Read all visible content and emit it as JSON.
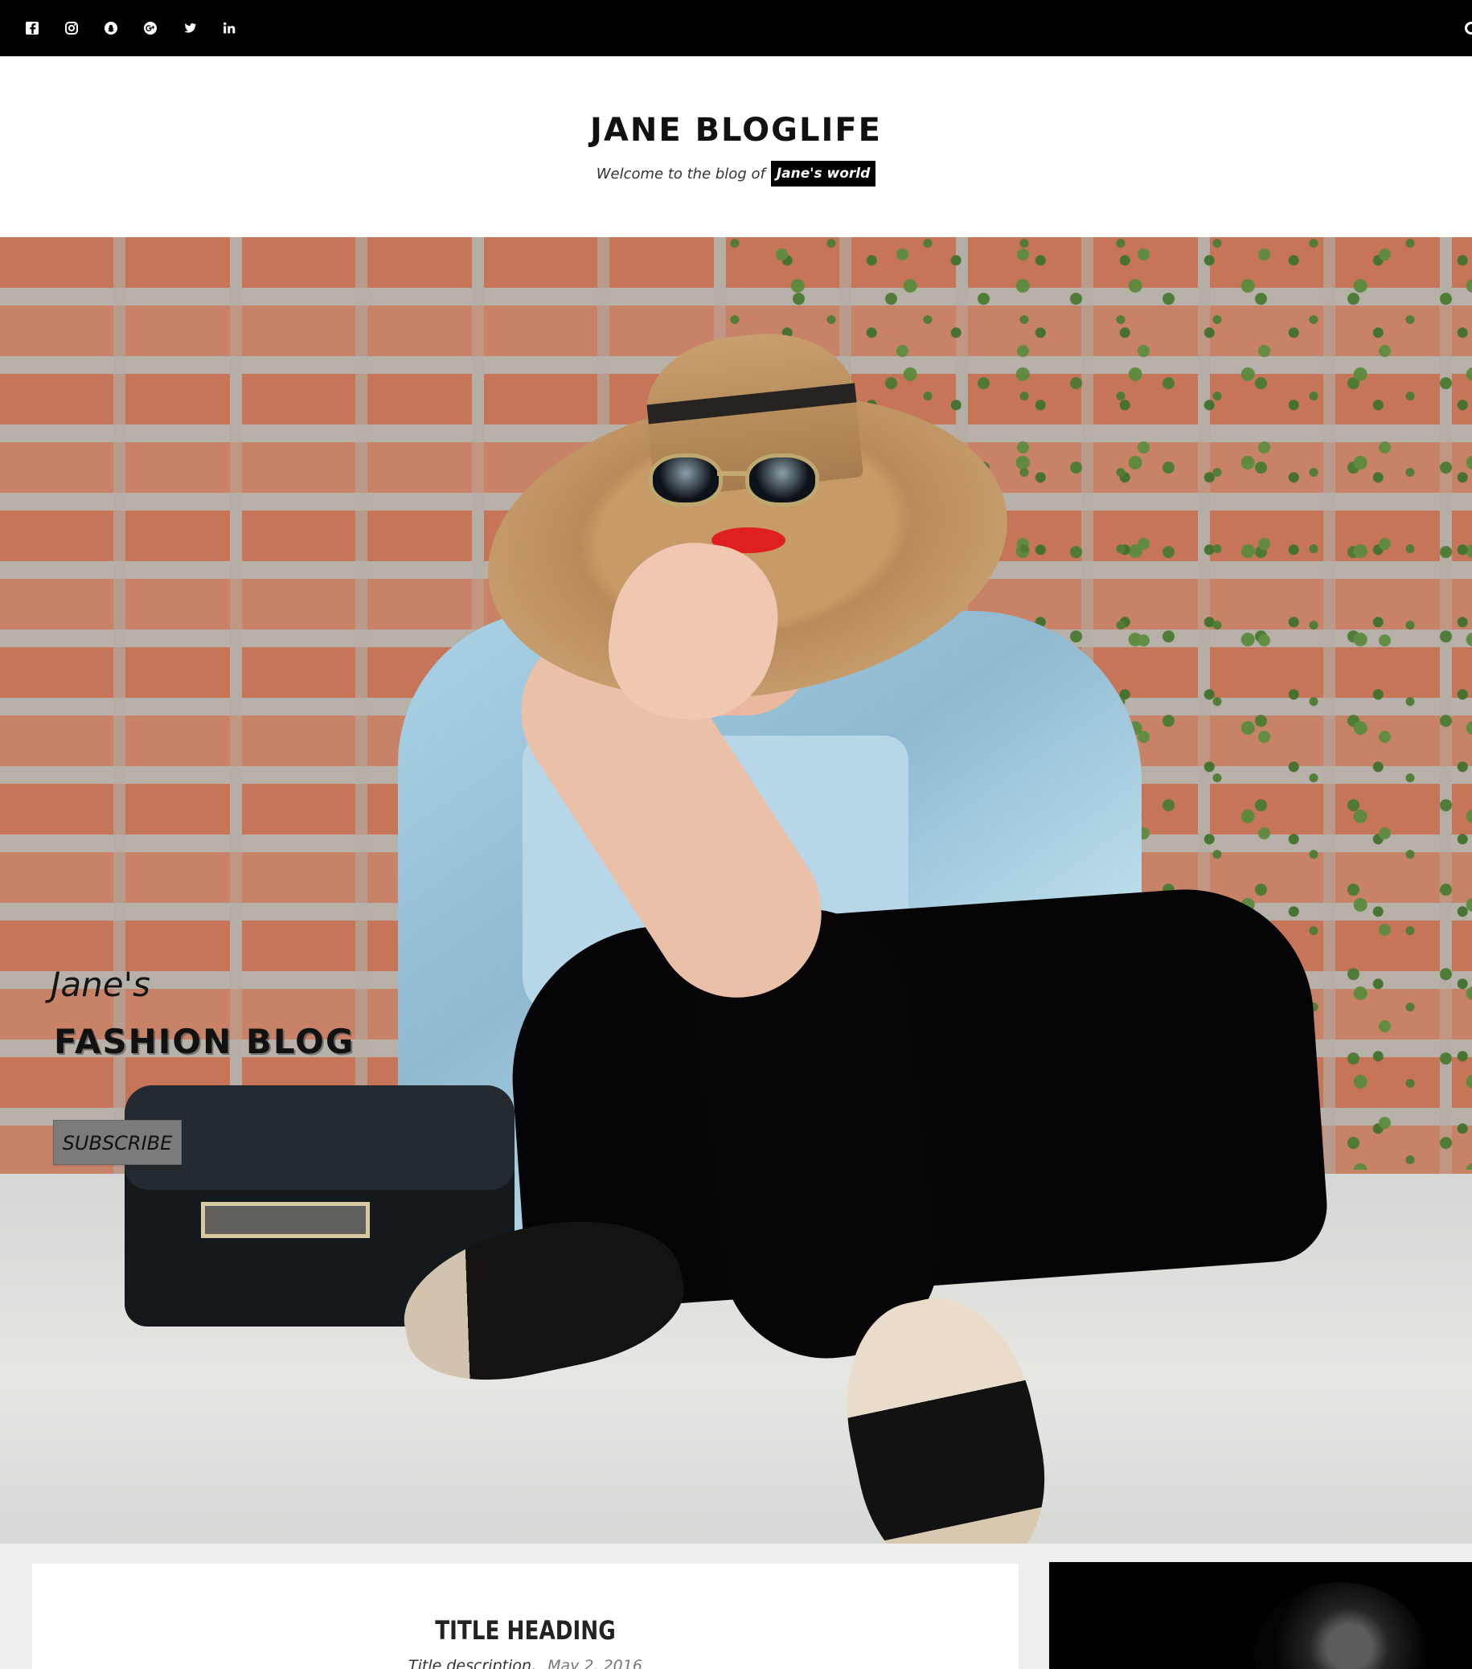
{
  "site": {
    "title": "JANE BLOGLIFE",
    "tagline": "Welcome to the blog of",
    "tagline_badge": "Jane's world"
  },
  "social_links": [
    {
      "name": "facebook-icon"
    },
    {
      "name": "instagram-icon"
    },
    {
      "name": "snapchat-icon"
    },
    {
      "name": "google-plus-icon"
    },
    {
      "name": "twitter-icon"
    },
    {
      "name": "linkedin-icon"
    }
  ],
  "hero": {
    "kicker": "Jane's",
    "title": "FASHION BLOG",
    "button_label": "SUBSCRIBE"
  },
  "post": {
    "title": "TITLE HEADING",
    "description": "Title description,",
    "date": "May 2, 2016"
  },
  "colors": {
    "top_bar": "#000000",
    "accent_badge": "#000000",
    "content_background": "#eeeeee",
    "card_background": "#ffffff",
    "hero_button": "#7b7b7b"
  }
}
